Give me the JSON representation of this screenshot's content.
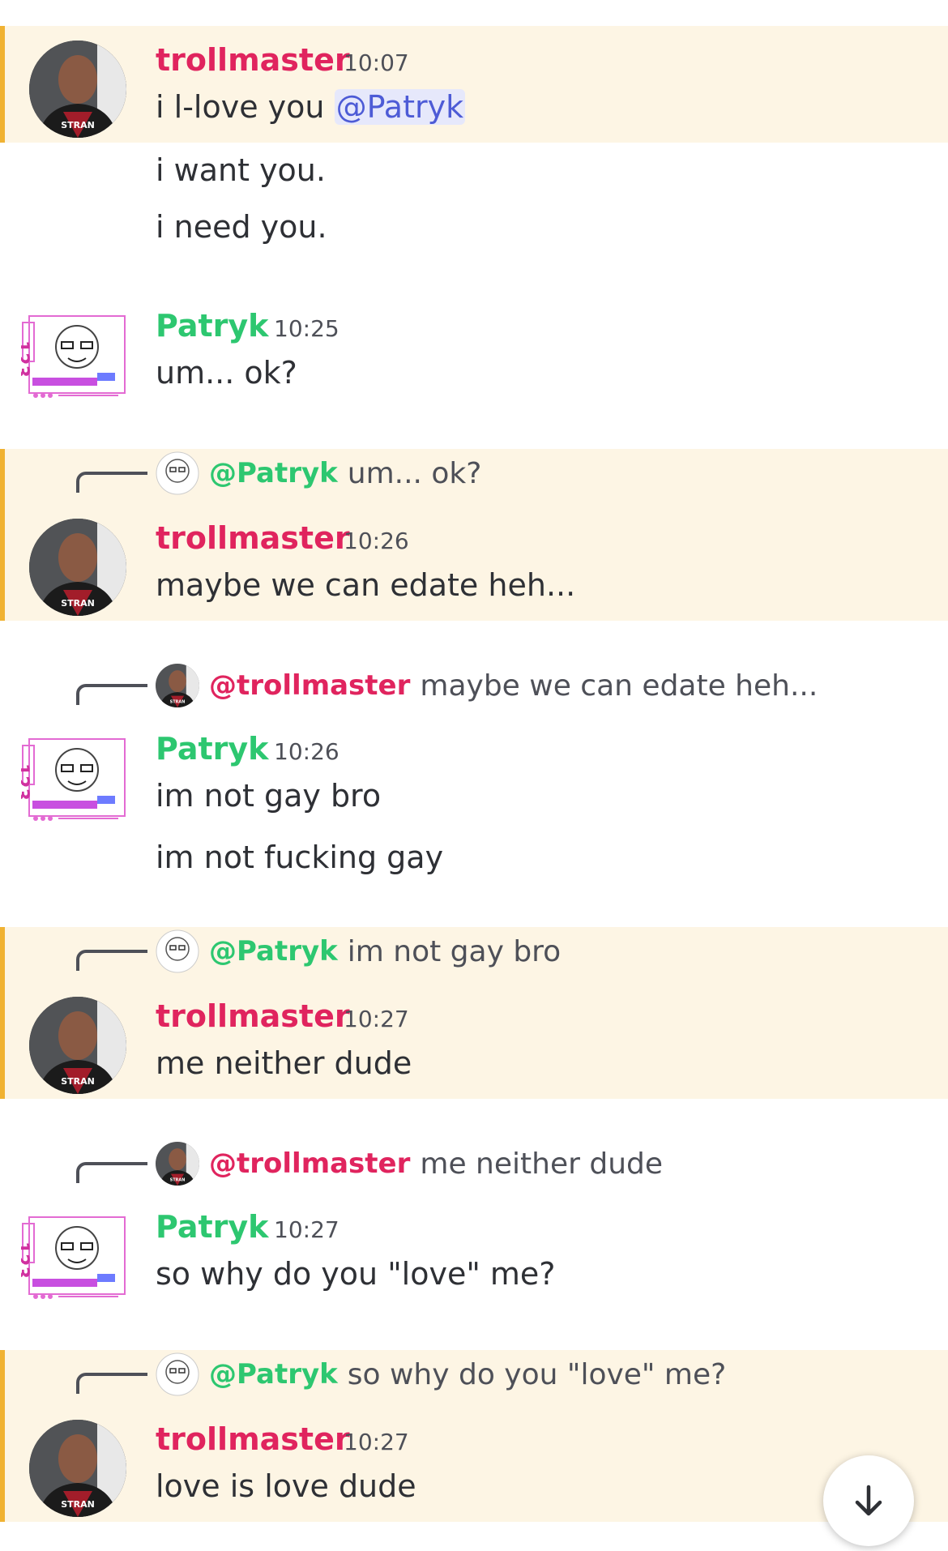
{
  "users": {
    "trollmaster": {
      "name": "trollmaster",
      "color": "#e0245e"
    },
    "patryk": {
      "name": "Patryk",
      "color": "#2dc770"
    }
  },
  "messages": [
    {
      "author": "trollmaster",
      "time": "10:07",
      "lines": [
        "i l-love you",
        "@Patryk",
        "i want you.",
        "i need you."
      ]
    },
    {
      "author": "Patryk",
      "time": "10:25",
      "lines": [
        "um... ok?"
      ]
    },
    {
      "reply_to": "@Patryk",
      "reply_text": "um... ok?",
      "author": "trollmaster",
      "time": "10:26",
      "lines": [
        "maybe we can edate heh..."
      ]
    },
    {
      "reply_to": "@trollmaster",
      "reply_text": "maybe we can edate heh...",
      "author": "Patryk",
      "time": "10:26",
      "lines": [
        "im not gay bro",
        "im not fucking gay"
      ]
    },
    {
      "reply_to": "@Patryk",
      "reply_text": "im not gay bro",
      "author": "trollmaster",
      "time": "10:27",
      "lines": [
        "me neither dude"
      ]
    },
    {
      "reply_to": "@trollmaster",
      "reply_text": "me neither dude",
      "author": "Patryk",
      "time": "10:27",
      "lines": [
        "so why do you \"love\" me?"
      ]
    },
    {
      "reply_to": "@Patryk",
      "reply_text": "so why do you \"love\" me?",
      "author": "trollmaster",
      "time": "10:27",
      "lines": [
        "love is love dude"
      ]
    }
  ],
  "scroll_button": {
    "icon": "arrow-down-icon"
  },
  "accent": {
    "highlight_bg": "#fdf5e4",
    "highlight_bar": "#f0b232",
    "mention": "#4d5bd6"
  }
}
